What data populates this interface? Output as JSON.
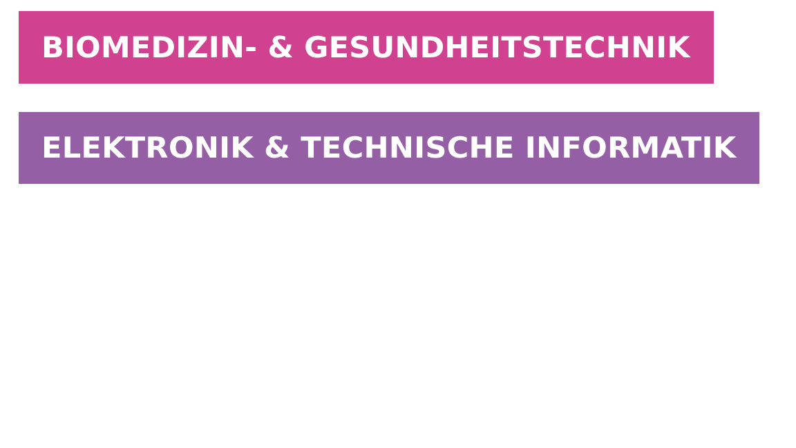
{
  "labels": [
    {
      "text": "BIOMEDIZIN- & GESUNDHEITSTECHNIK",
      "color": "#D0418F"
    },
    {
      "text": "ELEKTRONIK & TECHNISCHE INFORMATIK",
      "color": "#945FA5"
    }
  ]
}
